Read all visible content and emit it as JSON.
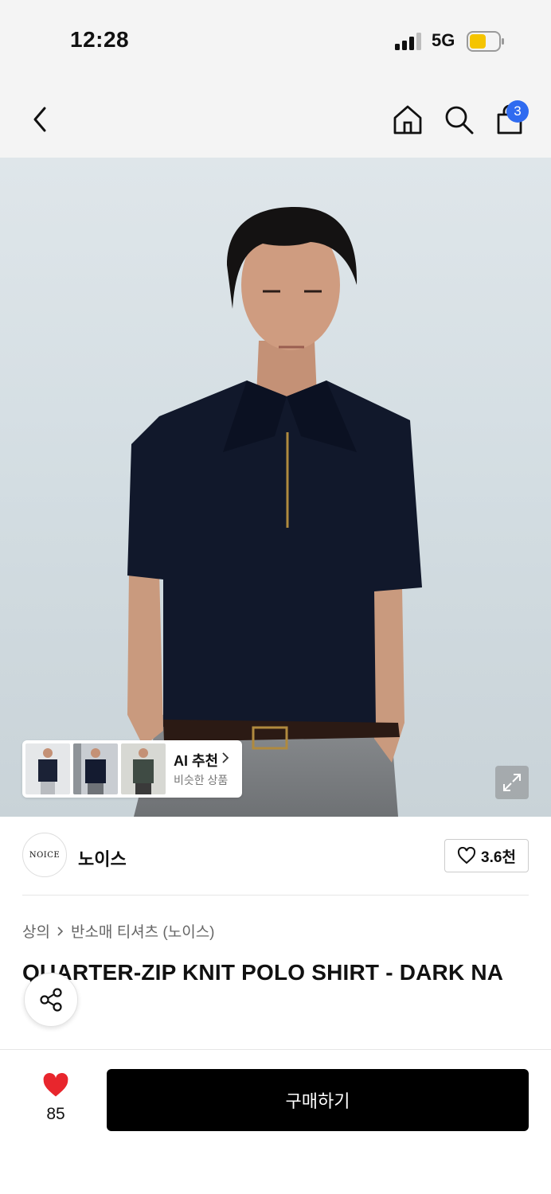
{
  "status_bar": {
    "time": "12:28",
    "network": "5G"
  },
  "nav": {
    "icons": [
      "chevron-left-icon",
      "home-icon",
      "search-icon",
      "shopping-bag-icon"
    ],
    "cart_count": "3",
    "badge_color": "#2f6bf0"
  },
  "ai_recommend": {
    "title": "AI 추천",
    "subtitle": "비슷한 상품"
  },
  "brand": {
    "logo_text": "NOICE",
    "name": "노이스",
    "likes": "3.6천"
  },
  "breadcrumb": {
    "category": "상의",
    "subcategory": "반소매 티셔츠 (노이스)"
  },
  "product": {
    "title": "QUARTER-ZIP KNIT POLO SHIRT - DARK NA"
  },
  "bottom_bar": {
    "heart_count": "85",
    "buy_label": "구매하기",
    "heart_color": "#e8262d"
  }
}
